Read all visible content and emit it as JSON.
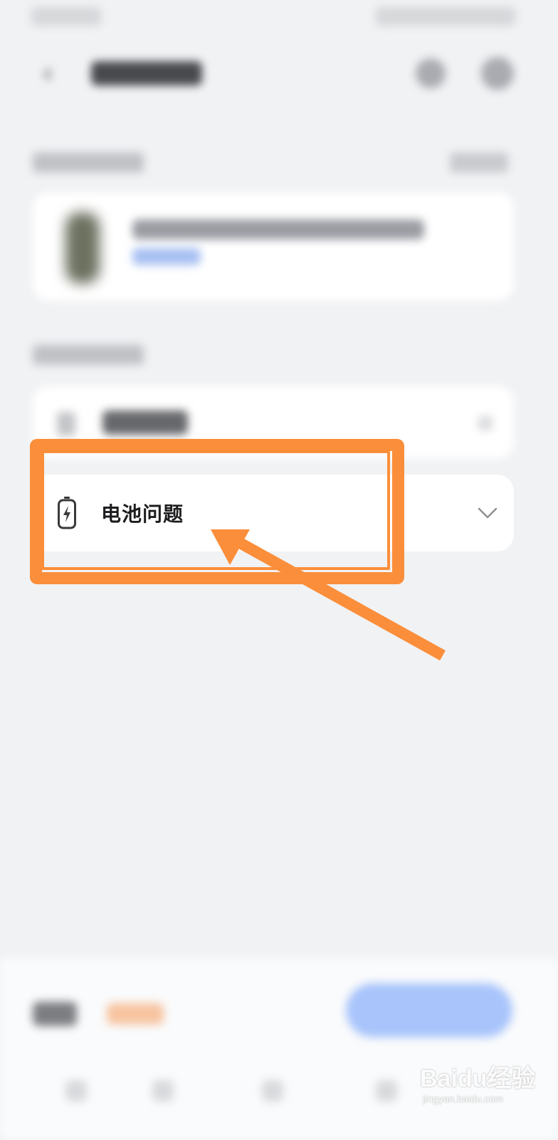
{
  "battery_item": {
    "label": "电池问题",
    "icon": "battery-charging-icon",
    "chevron": "chevron-down-icon"
  },
  "annotation": {
    "color": "#fb8e3a",
    "shapes": [
      "rectangle-highlight",
      "arrow"
    ]
  },
  "watermark": {
    "logo_text": "Baidu经验",
    "domain": "jingyan.baidu.com"
  },
  "colors": {
    "page_background": "#f1f2f4",
    "card_background": "#ffffff",
    "primary_button_blurred": "#a8c4fb",
    "accent_text_blurred": "#f7c4a0"
  }
}
